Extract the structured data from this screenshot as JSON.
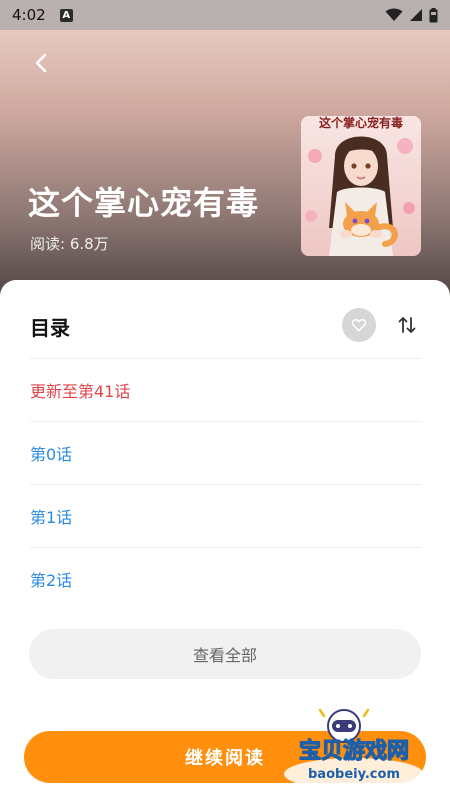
{
  "status_bar": {
    "time": "4:02",
    "indicator": "A",
    "icons": [
      "wifi-icon",
      "signal-icon",
      "battery-icon"
    ]
  },
  "book": {
    "title": "这个掌心宠有毒",
    "read_count": "阅读: 6.8万",
    "cover_text": "这个掌心宠有毒"
  },
  "toc": {
    "title": "目录",
    "chapters": [
      {
        "label": "更新至第41话",
        "style": "update"
      },
      {
        "label": "第0话",
        "style": "normal"
      },
      {
        "label": "第1话",
        "style": "normal"
      },
      {
        "label": "第2话",
        "style": "normal"
      }
    ],
    "view_all_label": "查看全部"
  },
  "actions": {
    "continue_label": "继续阅读"
  },
  "watermark": {
    "name": "宝贝游戏网",
    "url": "baobeiy.com"
  },
  "colors": {
    "accent": "#ff8f0c",
    "update": "#e0454c",
    "link": "#2b8be0"
  }
}
